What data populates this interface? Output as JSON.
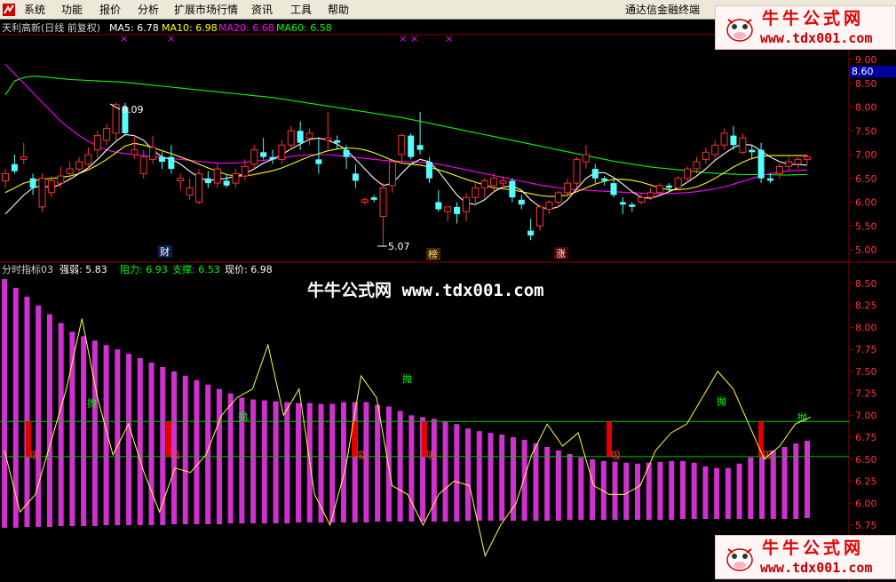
{
  "menu": {
    "items": [
      "系统",
      "功能",
      "报价",
      "分析",
      "扩展市场行情",
      "资讯",
      "工具",
      "帮助"
    ],
    "terminal_name": "通达信金融终端"
  },
  "watermark": {
    "title": "牛牛公式网",
    "url": "www.tdx001.com",
    "center_text": "牛牛公式网 www.tdx001.com"
  },
  "upper": {
    "title": "天利高新(日线 前复权)",
    "ma5_label": "MA5: 6.78",
    "ma10_label": "MA10: 6.98",
    "ma20_label": "MA20: 6.68",
    "ma60_label": "MA60: 6.58",
    "current_price_tag": "8.60",
    "annot_high": "8.09",
    "annot_low": "5.07",
    "marker_1": "财",
    "marker_2": "榜",
    "marker_3": "涨",
    "axis_ticks": [
      "9.00",
      "8.50",
      "8.00",
      "7.50",
      "7.00",
      "6.50",
      "6.00",
      "5.50",
      "5.00"
    ]
  },
  "lower": {
    "title": "分时指标03",
    "strength_label": "强弱: 5.83",
    "resistance_label": "阻力: 6.93",
    "support_label": "支撑: 6.53",
    "price_label": "现价: 6.98",
    "axis_ticks": [
      "8.50",
      "8.25",
      "8.00",
      "7.75",
      "7.50",
      "7.25",
      "7.00",
      "6.75",
      "6.50",
      "6.25",
      "6.00",
      "5.75"
    ],
    "buy_label": "吸",
    "sell_label": "抛"
  },
  "colors": {
    "up_candle": "#ff3232",
    "down_candle": "#54ffff",
    "ma5": "#ffffff",
    "ma10": "#ffff00",
    "ma20": "#ff00ff",
    "ma60": "#00ff00",
    "bars": "#d030d0",
    "grid": "#880000",
    "axis_text": "#ff3232"
  },
  "chart_data": [
    {
      "type": "candlestick",
      "title": "天利高新(日线 前复权)",
      "ylim": [
        4.85,
        9.2
      ],
      "y_ticks": [
        9.0,
        8.5,
        8.0,
        7.5,
        7.0,
        6.5,
        6.0,
        5.5,
        5.0
      ],
      "ohlc": [
        [
          6.45,
          6.7,
          6.3,
          6.6
        ],
        [
          6.8,
          7.0,
          6.6,
          6.65
        ],
        [
          6.9,
          7.25,
          6.8,
          6.95
        ],
        [
          6.5,
          6.6,
          6.15,
          6.3
        ],
        [
          5.9,
          6.6,
          5.8,
          6.5
        ],
        [
          6.2,
          6.55,
          6.1,
          6.45
        ],
        [
          6.4,
          6.75,
          6.3,
          6.55
        ],
        [
          6.6,
          6.85,
          6.5,
          6.7
        ],
        [
          6.7,
          6.95,
          6.6,
          6.85
        ],
        [
          6.8,
          7.15,
          6.7,
          7.0
        ],
        [
          7.1,
          7.5,
          6.95,
          7.4
        ],
        [
          7.3,
          7.65,
          7.2,
          7.55
        ],
        [
          7.45,
          8.1,
          7.3,
          8.05
        ],
        [
          8.0,
          8.09,
          7.4,
          7.45
        ],
        [
          7.0,
          7.4,
          6.9,
          7.1
        ],
        [
          6.6,
          7.1,
          6.5,
          6.95
        ],
        [
          6.9,
          7.4,
          6.8,
          7.15
        ],
        [
          6.95,
          7.05,
          6.7,
          6.85
        ],
        [
          6.95,
          7.2,
          6.6,
          6.7
        ],
        [
          6.45,
          6.6,
          6.25,
          6.5
        ],
        [
          6.15,
          6.5,
          6.05,
          6.3
        ],
        [
          6.0,
          6.7,
          5.95,
          6.6
        ],
        [
          6.5,
          6.65,
          6.3,
          6.4
        ],
        [
          6.4,
          6.8,
          6.3,
          6.7
        ],
        [
          6.45,
          6.6,
          6.3,
          6.35
        ],
        [
          6.4,
          6.7,
          6.3,
          6.6
        ],
        [
          6.55,
          6.9,
          6.45,
          6.75
        ],
        [
          6.8,
          7.2,
          6.7,
          7.1
        ],
        [
          7.05,
          7.35,
          6.9,
          6.95
        ],
        [
          6.95,
          7.1,
          6.8,
          6.9
        ],
        [
          6.9,
          7.3,
          6.8,
          7.2
        ],
        [
          7.2,
          7.6,
          7.1,
          7.5
        ],
        [
          7.5,
          7.7,
          7.1,
          7.25
        ],
        [
          7.35,
          7.55,
          7.2,
          7.45
        ],
        [
          6.9,
          7.35,
          6.6,
          6.8
        ],
        [
          7.3,
          7.9,
          7.1,
          7.35
        ],
        [
          7.3,
          7.4,
          7.1,
          7.25
        ],
        [
          7.1,
          7.2,
          6.7,
          6.95
        ],
        [
          6.6,
          6.8,
          6.3,
          6.45
        ],
        [
          6.0,
          6.1,
          5.95,
          6.05
        ],
        [
          6.1,
          6.15,
          6.0,
          6.05
        ],
        [
          5.7,
          6.4,
          5.07,
          6.3
        ],
        [
          6.35,
          6.9,
          6.2,
          6.85
        ],
        [
          7.0,
          7.45,
          6.8,
          7.4
        ],
        [
          7.4,
          7.45,
          6.9,
          6.95
        ],
        [
          7.2,
          7.9,
          7.0,
          7.1
        ],
        [
          6.85,
          6.95,
          6.4,
          6.5
        ],
        [
          6.0,
          6.25,
          5.8,
          5.85
        ],
        [
          5.8,
          5.9,
          5.6,
          5.9
        ],
        [
          5.9,
          6.0,
          5.55,
          5.75
        ],
        [
          5.8,
          6.2,
          5.6,
          6.1
        ],
        [
          6.1,
          6.4,
          5.95,
          6.3
        ],
        [
          6.3,
          6.5,
          6.1,
          6.45
        ],
        [
          6.35,
          6.6,
          6.2,
          6.5
        ],
        [
          6.4,
          6.55,
          6.3,
          6.45
        ],
        [
          6.45,
          6.5,
          6.0,
          6.1
        ],
        [
          6.05,
          6.15,
          5.85,
          5.95
        ],
        [
          5.4,
          5.65,
          5.2,
          5.3
        ],
        [
          5.5,
          5.95,
          5.4,
          5.9
        ],
        [
          5.85,
          6.05,
          5.75,
          6.0
        ],
        [
          6.0,
          6.25,
          5.9,
          6.2
        ],
        [
          6.2,
          6.5,
          6.1,
          6.4
        ],
        [
          6.4,
          6.95,
          6.3,
          6.9
        ],
        [
          6.85,
          7.2,
          6.7,
          7.0
        ],
        [
          6.7,
          6.8,
          6.4,
          6.5
        ],
        [
          6.5,
          6.55,
          6.35,
          6.45
        ],
        [
          6.4,
          6.5,
          6.1,
          6.15
        ],
        [
          6.0,
          6.1,
          5.75,
          5.95
        ],
        [
          5.95,
          6.0,
          5.8,
          5.9
        ],
        [
          6.0,
          6.2,
          5.95,
          6.1
        ],
        [
          6.1,
          6.3,
          6.05,
          6.2
        ],
        [
          6.2,
          6.4,
          6.15,
          6.35
        ],
        [
          6.35,
          6.4,
          6.2,
          6.3
        ],
        [
          6.3,
          6.55,
          6.25,
          6.5
        ],
        [
          6.5,
          6.75,
          6.4,
          6.7
        ],
        [
          6.7,
          6.95,
          6.6,
          6.85
        ],
        [
          6.9,
          7.15,
          6.8,
          7.05
        ],
        [
          7.0,
          7.3,
          6.9,
          7.2
        ],
        [
          7.2,
          7.55,
          7.1,
          7.45
        ],
        [
          7.4,
          7.6,
          7.1,
          7.2
        ],
        [
          7.05,
          7.45,
          7.0,
          7.35
        ],
        [
          7.1,
          7.2,
          6.9,
          7.05
        ],
        [
          7.1,
          7.25,
          6.4,
          6.5
        ],
        [
          6.5,
          6.6,
          6.4,
          6.45
        ],
        [
          6.6,
          6.8,
          6.5,
          6.75
        ],
        [
          6.75,
          6.95,
          6.65,
          6.85
        ],
        [
          6.8,
          6.95,
          6.7,
          6.9
        ],
        [
          6.9,
          7.0,
          6.8,
          6.95
        ]
      ],
      "ma60": [
        8.25,
        8.55,
        8.62,
        8.65,
        8.64,
        8.62,
        8.6,
        8.58,
        8.57,
        8.56,
        8.55,
        8.54,
        8.53,
        8.52,
        8.5,
        8.48,
        8.46,
        8.44,
        8.42,
        8.4,
        8.38,
        8.36,
        8.34,
        8.32,
        8.3,
        8.28,
        8.26,
        8.24,
        8.22,
        8.2,
        8.17,
        8.14,
        8.11,
        8.08,
        8.05,
        8.02,
        7.99,
        7.96,
        7.93,
        7.9,
        7.87,
        7.84,
        7.81,
        7.78,
        7.74,
        7.7,
        7.66,
        7.62,
        7.58,
        7.54,
        7.5,
        7.46,
        7.42,
        7.38,
        7.34,
        7.3,
        7.26,
        7.22,
        7.18,
        7.14,
        7.1,
        7.06,
        7.02,
        6.98,
        6.94,
        6.9,
        6.86,
        6.83,
        6.8,
        6.77,
        6.74,
        6.72,
        6.7,
        6.68,
        6.66,
        6.64,
        6.62,
        6.61,
        6.6,
        6.59,
        6.58,
        6.58,
        6.58,
        6.58,
        6.57,
        6.57,
        6.58,
        6.58
      ],
      "ma20": [
        8.9,
        8.7,
        8.5,
        8.3,
        8.1,
        7.9,
        7.7,
        7.55,
        7.4,
        7.28,
        7.18,
        7.1,
        7.05,
        7.02,
        7.0,
        6.98,
        6.96,
        6.94,
        6.92,
        6.9,
        6.88,
        6.86,
        6.84,
        6.82,
        6.82,
        6.82,
        6.84,
        6.86,
        6.88,
        6.9,
        6.93,
        6.96,
        6.98,
        7.0,
        7.0,
        7.0,
        6.98,
        6.96,
        6.94,
        6.92,
        6.9,
        6.88,
        6.87,
        6.86,
        6.85,
        6.84,
        6.82,
        6.8,
        6.76,
        6.72,
        6.68,
        6.64,
        6.6,
        6.56,
        6.52,
        6.48,
        6.44,
        6.4,
        6.36,
        6.33,
        6.3,
        6.28,
        6.26,
        6.25,
        6.24,
        6.23,
        6.22,
        6.21,
        6.2,
        6.19,
        6.18,
        6.18,
        6.18,
        6.19,
        6.2,
        6.22,
        6.25,
        6.28,
        6.32,
        6.38,
        6.44,
        6.5,
        6.56,
        6.6,
        6.63,
        6.66,
        6.67,
        6.68
      ],
      "ma10": [
        6.2,
        6.3,
        6.4,
        6.45,
        6.48,
        6.5,
        6.52,
        6.55,
        6.6,
        6.68,
        6.78,
        6.9,
        7.04,
        7.18,
        7.24,
        7.2,
        7.15,
        7.08,
        7.02,
        6.95,
        6.88,
        6.8,
        6.72,
        6.65,
        6.58,
        6.55,
        6.55,
        6.58,
        6.62,
        6.66,
        6.72,
        6.8,
        6.88,
        6.96,
        7.02,
        7.08,
        7.12,
        7.14,
        7.13,
        7.1,
        7.04,
        6.96,
        6.88,
        6.82,
        6.8,
        6.78,
        6.74,
        6.68,
        6.62,
        6.55,
        6.48,
        6.42,
        6.36,
        6.3,
        6.28,
        6.26,
        6.22,
        6.18,
        6.14,
        6.12,
        6.12,
        6.15,
        6.22,
        6.3,
        6.38,
        6.44,
        6.48,
        6.48,
        6.46,
        6.42,
        6.36,
        6.3,
        6.26,
        6.26,
        6.28,
        6.32,
        6.4,
        6.5,
        6.62,
        6.74,
        6.84,
        6.92,
        6.96,
        6.98,
        6.98,
        6.98,
        6.98,
        6.98
      ],
      "ma5": [
        5.75,
        5.95,
        6.15,
        6.3,
        6.35,
        6.3,
        6.38,
        6.48,
        6.6,
        6.72,
        6.9,
        7.1,
        7.28,
        7.42,
        7.4,
        7.3,
        7.1,
        6.95,
        6.9,
        6.8,
        6.65,
        6.52,
        6.45,
        6.48,
        6.5,
        6.55,
        6.6,
        6.7,
        6.82,
        6.9,
        7.0,
        7.12,
        7.22,
        7.32,
        7.35,
        7.3,
        7.22,
        7.1,
        6.9,
        6.7,
        6.5,
        6.35,
        6.4,
        6.6,
        6.8,
        6.9,
        6.85,
        6.65,
        6.4,
        6.15,
        5.98,
        5.95,
        6.05,
        6.22,
        6.32,
        6.34,
        6.25,
        6.05,
        5.9,
        5.85,
        5.9,
        6.05,
        6.28,
        6.5,
        6.62,
        6.62,
        6.52,
        6.38,
        6.22,
        6.1,
        6.08,
        6.14,
        6.22,
        6.3,
        6.42,
        6.55,
        6.7,
        6.88,
        7.02,
        7.15,
        7.22,
        7.2,
        7.08,
        6.95,
        6.85,
        6.8,
        6.79,
        6.78
      ]
    },
    {
      "type": "bar+line",
      "title": "分时指标03",
      "ylim": [
        5.6,
        8.6
      ],
      "y_ticks": [
        8.5,
        8.25,
        8.0,
        7.75,
        7.5,
        7.25,
        7.0,
        6.75,
        6.5,
        6.25,
        6.0,
        5.75
      ],
      "resistance": 6.93,
      "support": 6.53,
      "bar_base": [
        5.72,
        5.72,
        5.73,
        5.73,
        5.73,
        5.74,
        5.74,
        5.74,
        5.74,
        5.75,
        5.75,
        5.75,
        5.75,
        5.75,
        5.75,
        5.76,
        5.76,
        5.76,
        5.76,
        5.76,
        5.77,
        5.77,
        5.77,
        5.77,
        5.77,
        5.77,
        5.78,
        5.78,
        5.78,
        5.78,
        5.78,
        5.78,
        5.78,
        5.79,
        5.79,
        5.79,
        5.79,
        5.79,
        5.79,
        5.79,
        5.79,
        5.8,
        5.8,
        5.8,
        5.8,
        5.8,
        5.8,
        5.8,
        5.8,
        5.8,
        5.81,
        5.81,
        5.81,
        5.81,
        5.81,
        5.81,
        5.81,
        5.81,
        5.81,
        5.81,
        5.82,
        5.82,
        5.82,
        5.82,
        5.82,
        5.82,
        5.82,
        5.82,
        5.82,
        5.82,
        5.82,
        5.83
      ],
      "bar_top": [
        8.55,
        8.45,
        8.35,
        8.25,
        8.15,
        8.05,
        7.95,
        7.9,
        7.85,
        7.8,
        7.75,
        7.7,
        7.65,
        7.6,
        7.55,
        7.5,
        7.45,
        7.4,
        7.35,
        7.3,
        7.25,
        7.2,
        7.18,
        7.17,
        7.16,
        7.15,
        7.14,
        7.14,
        7.13,
        7.13,
        7.15,
        7.15,
        7.15,
        7.12,
        7.1,
        7.05,
        7.0,
        6.98,
        6.96,
        6.93,
        6.9,
        6.85,
        6.82,
        6.8,
        6.78,
        6.75,
        6.72,
        6.68,
        6.64,
        6.6,
        6.56,
        6.52,
        6.5,
        6.48,
        6.47,
        6.46,
        6.45,
        6.46,
        6.47,
        6.48,
        6.48,
        6.46,
        6.42,
        6.4,
        6.4,
        6.45,
        6.52,
        6.55,
        6.6,
        6.64,
        6.68,
        6.71
      ],
      "line": [
        6.6,
        5.9,
        6.1,
        6.7,
        7.3,
        8.1,
        7.2,
        6.55,
        6.9,
        6.35,
        5.9,
        6.4,
        6.35,
        6.55,
        7.0,
        7.2,
        7.3,
        7.8,
        7.0,
        7.3,
        6.1,
        5.75,
        6.4,
        7.45,
        7.2,
        6.2,
        6.1,
        5.75,
        6.1,
        6.25,
        6.2,
        5.4,
        5.75,
        6.0,
        6.55,
        6.9,
        6.65,
        6.8,
        6.2,
        6.1,
        6.1,
        6.2,
        6.6,
        6.8,
        6.9,
        7.2,
        7.5,
        7.3,
        6.9,
        6.5,
        6.65,
        6.9,
        6.98
      ],
      "buy_markers": 7,
      "sell_markers": 6
    }
  ]
}
